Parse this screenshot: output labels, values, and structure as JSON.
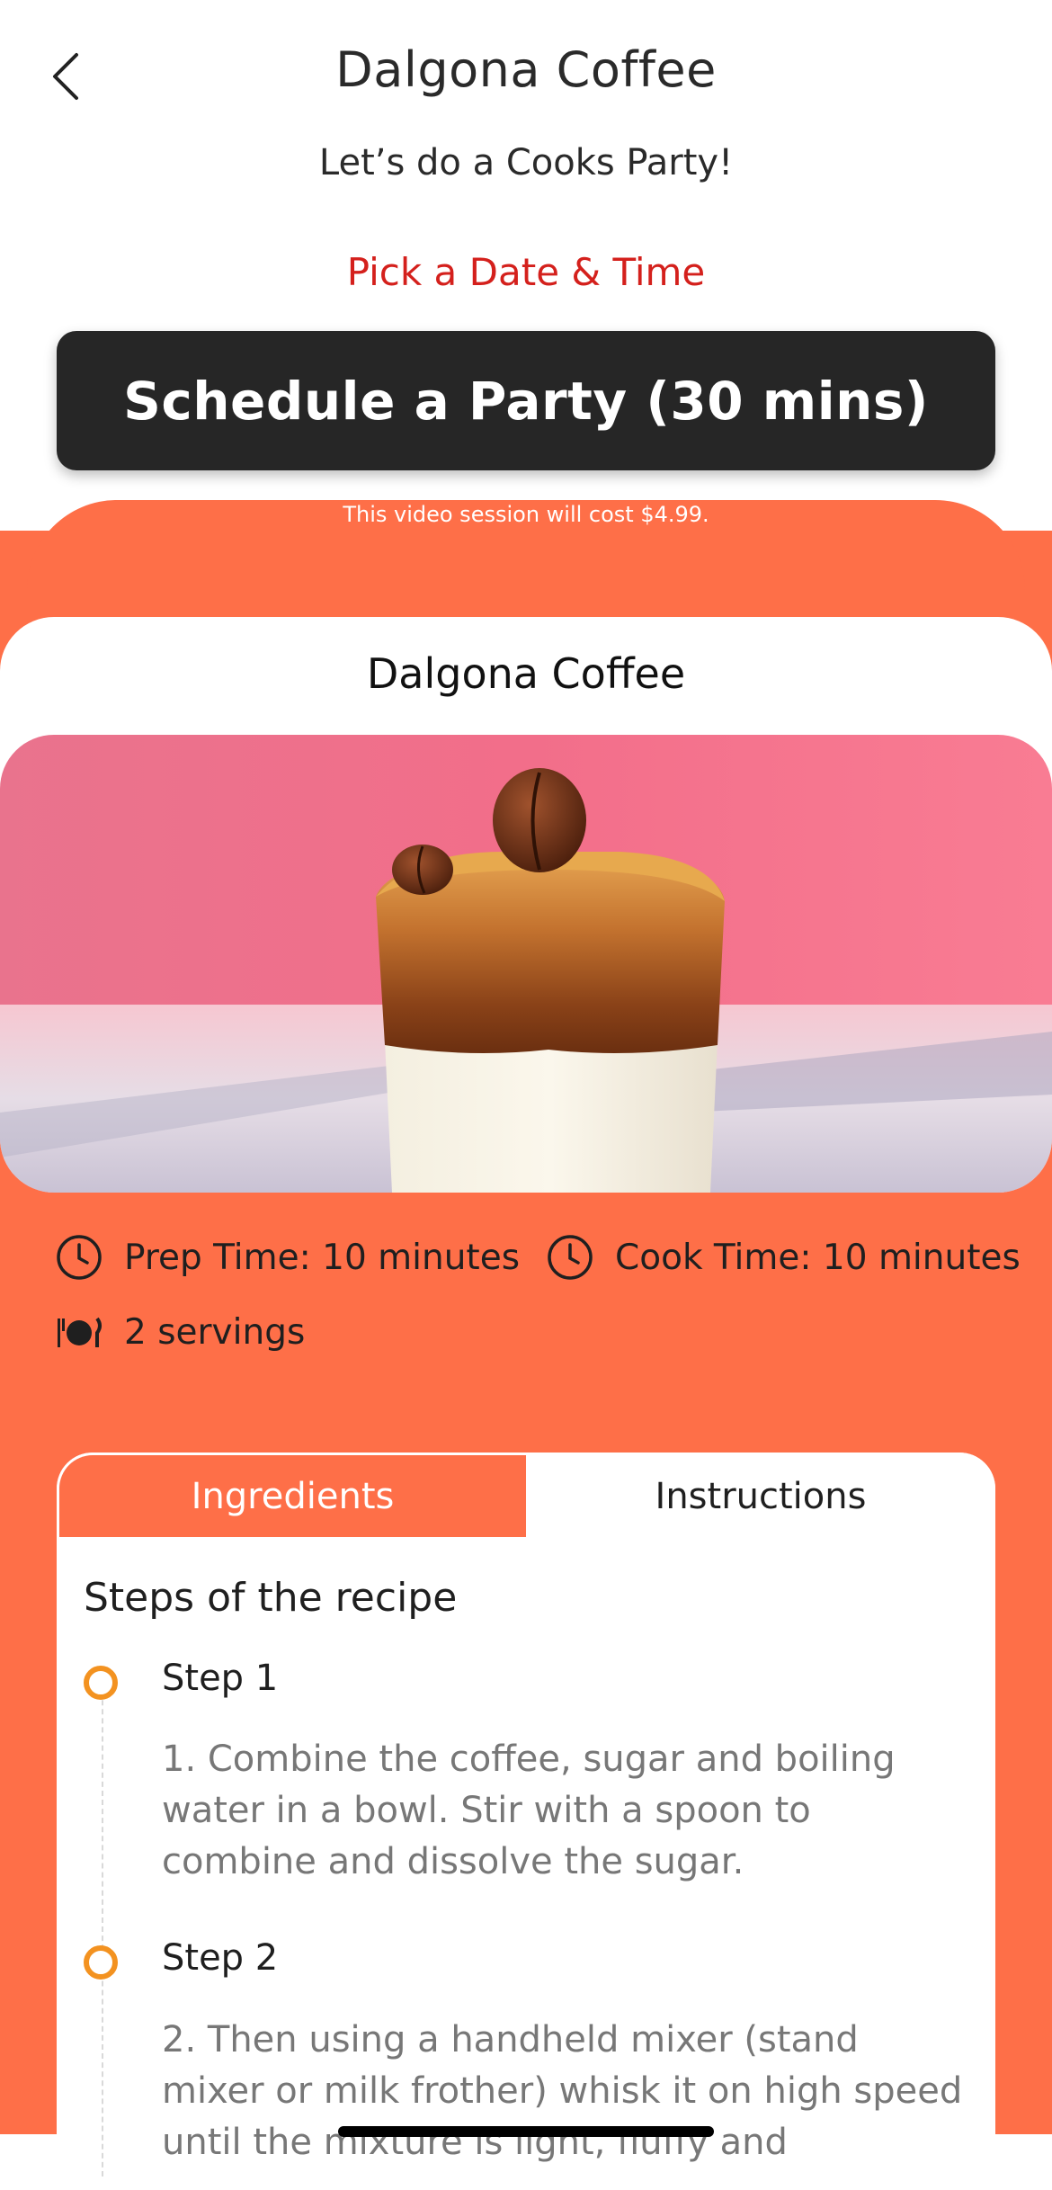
{
  "header": {
    "title": "Dalgona Coffee",
    "subtitle": "Let’s do a Cooks Party!",
    "pick_link": "Pick a Date & Time",
    "schedule_button": "Schedule a Party (30 mins)",
    "cost_note": "This video session will cost $4.99."
  },
  "recipe": {
    "card_title": "Dalgona Coffee",
    "prep_time": "Prep Time: 10 minutes",
    "cook_time": "Cook Time: 10 minutes",
    "servings": "2 servings"
  },
  "tabs": [
    {
      "label": "Ingredients",
      "active": true
    },
    {
      "label": "Instructions",
      "active": false
    }
  ],
  "instructions": {
    "heading": "Steps of the recipe",
    "steps": [
      {
        "label": "Step 1",
        "text": "1. Combine the coffee, sugar and boiling water in a bowl. Stir with a spoon to combine and dissolve the sugar."
      },
      {
        "label": "Step 2",
        "text": "2. Then using a handheld mixer (stand mixer or milk frother) whisk it on high speed until the mixture is light, fluffy and"
      }
    ]
  },
  "colors": {
    "accent": "#fe6f48",
    "link_red": "#d4201c",
    "button_dark": "#262626",
    "step_dot": "#f39220"
  },
  "icons": {
    "back": "chevron-left-icon",
    "prep": "clock-icon",
    "cook": "clock-icon",
    "servings": "plate-cutlery-icon"
  }
}
